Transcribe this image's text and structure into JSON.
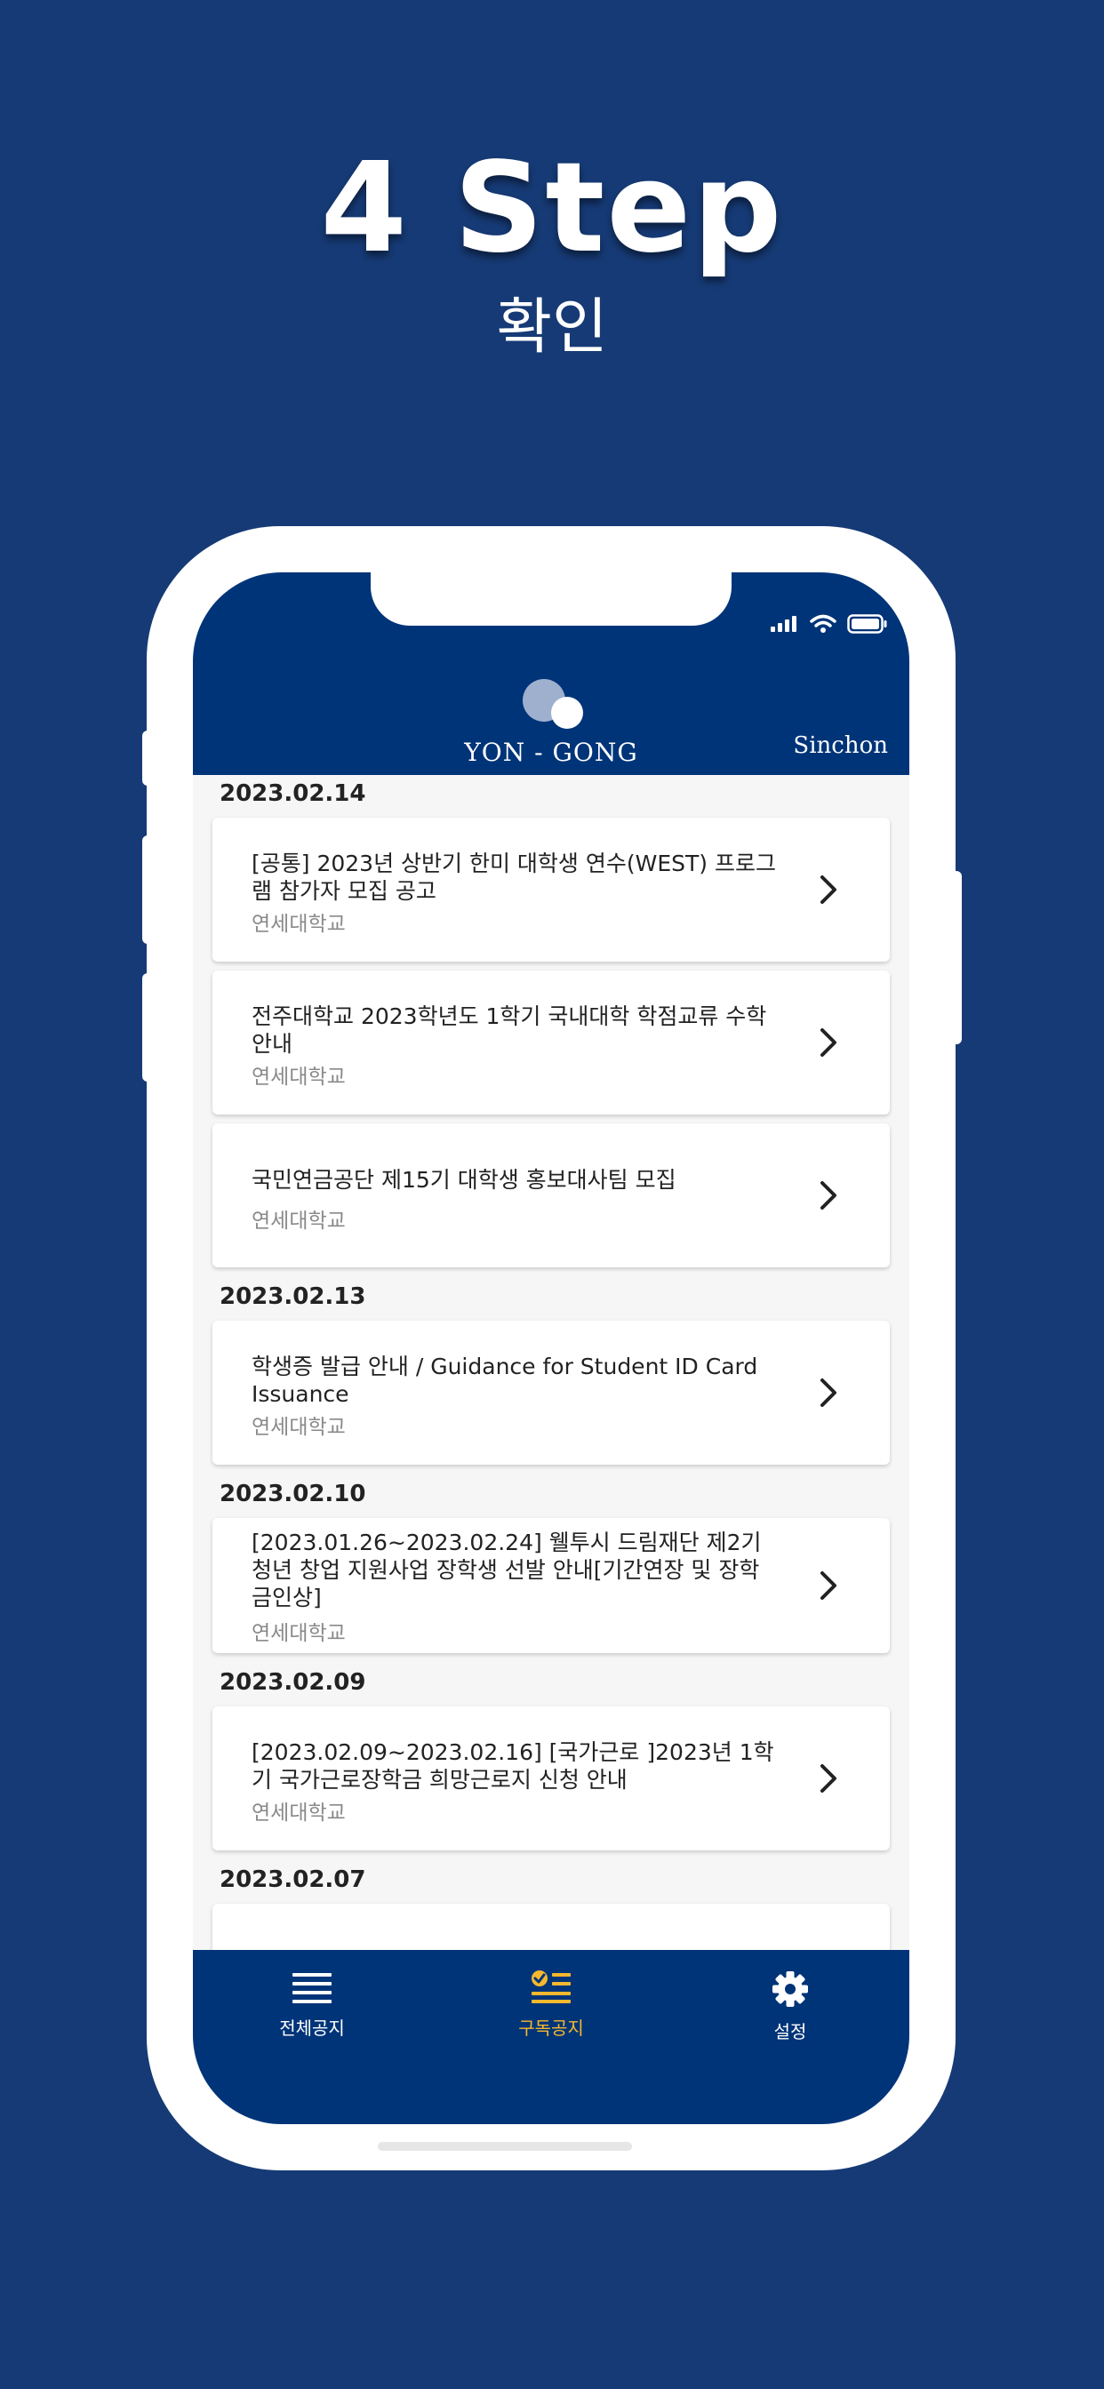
{
  "promo": {
    "title": "4 Step",
    "subtitle": "확인"
  },
  "app": {
    "logo_text": "YON - GONG",
    "campus": "Sinchon"
  },
  "notices": [
    {
      "date": "2023.02.14",
      "items": [
        {
          "title": "[공통] 2023년 상반기 한미 대학생 연수(WEST) 프로그램 참가자 모집 공고",
          "source": "연세대학교"
        },
        {
          "title": "전주대학교 2023학년도 1학기 국내대학 학점교류 수학 안내",
          "source": "연세대학교"
        },
        {
          "title": "국민연금공단 제15기 대학생 홍보대사팀 모집",
          "source": "연세대학교"
        }
      ]
    },
    {
      "date": "2023.02.13",
      "items": [
        {
          "title": "학생증 발급 안내 / Guidance for Student ID Card Issuance",
          "source": "연세대학교"
        }
      ]
    },
    {
      "date": "2023.02.10",
      "items": [
        {
          "title": "[2023.01.26~2023.02.24] 웰투시 드림재단 제2기 청년 창업 지원사업 장학생 선발 안내[기간연장 및 장학금인상]",
          "source": "연세대학교"
        }
      ]
    },
    {
      "date": "2023.02.09",
      "items": [
        {
          "title": "[2023.02.09~2023.02.16] [국가근로 ]2023년 1학기 국가근로장학금 희망근로지  신청 안내",
          "source": "연세대학교"
        }
      ]
    },
    {
      "date": "2023.02.07",
      "items": []
    }
  ],
  "tabbar": {
    "all": "전체공지",
    "subscribed": "구독공지",
    "settings": "설정",
    "active": "subscribed"
  },
  "colors": {
    "background": "#163a75",
    "header": "#003478",
    "active_tab": "#f5b82e",
    "inactive_tab": "#ffffff"
  },
  "icons": {
    "chevron": "chevron-right-icon",
    "all_tab": "list-icon",
    "subscribed_tab": "checklist-icon",
    "settings_tab": "gear-icon"
  }
}
